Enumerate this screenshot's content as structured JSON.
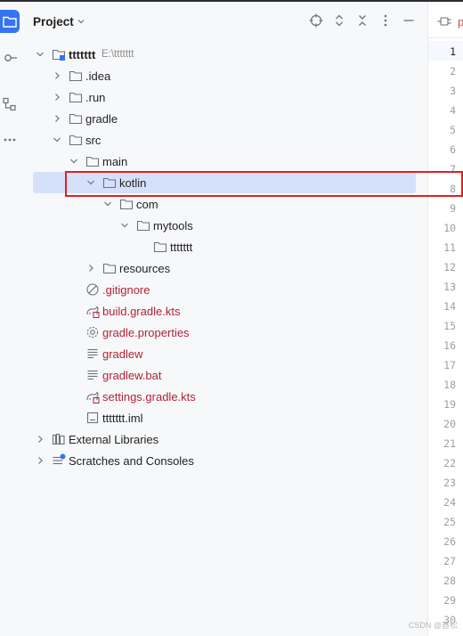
{
  "panel": {
    "title": "Project"
  },
  "tree": [
    {
      "label": "ttttttt",
      "path": "E:\\ttttttt",
      "level": 0,
      "expanded": true,
      "icon": "module-folder-icon",
      "bold": true
    },
    {
      "label": ".idea",
      "level": 1,
      "expanded": false,
      "icon": "folder-icon"
    },
    {
      "label": ".run",
      "level": 1,
      "expanded": false,
      "icon": "folder-icon"
    },
    {
      "label": "gradle",
      "level": 1,
      "expanded": false,
      "icon": "folder-icon"
    },
    {
      "label": "src",
      "level": 1,
      "expanded": true,
      "icon": "folder-icon"
    },
    {
      "label": "main",
      "level": 2,
      "expanded": true,
      "icon": "folder-icon"
    },
    {
      "label": "kotlin",
      "level": 3,
      "expanded": true,
      "icon": "folder-icon",
      "selected": true
    },
    {
      "label": "com",
      "level": 4,
      "expanded": true,
      "icon": "folder-icon"
    },
    {
      "label": "mytools",
      "level": 5,
      "expanded": true,
      "icon": "folder-icon"
    },
    {
      "label": "ttttttt",
      "level": 6,
      "icon": "folder-icon"
    },
    {
      "label": "resources",
      "level": 3,
      "expanded": false,
      "icon": "folder-icon"
    },
    {
      "label": ".gitignore",
      "level": 2,
      "icon": "ignore-file-icon",
      "red": true
    },
    {
      "label": "build.gradle.kts",
      "level": 2,
      "icon": "gradle-file-icon",
      "red": true
    },
    {
      "label": "gradle.properties",
      "level": 2,
      "icon": "settings-file-icon",
      "red": true
    },
    {
      "label": "gradlew",
      "level": 2,
      "icon": "text-file-icon",
      "red": true
    },
    {
      "label": "gradlew.bat",
      "level": 2,
      "icon": "text-file-icon",
      "red": true
    },
    {
      "label": "settings.gradle.kts",
      "level": 2,
      "icon": "gradle-file-icon",
      "red": true
    },
    {
      "label": "ttttttt.iml",
      "level": 2,
      "icon": "iml-file-icon"
    },
    {
      "label": "External Libraries",
      "level": 0,
      "expanded": false,
      "icon": "libraries-icon"
    },
    {
      "label": "Scratches and Consoles",
      "level": 0,
      "expanded": false,
      "icon": "scratches-icon"
    }
  ],
  "editor": {
    "tab_label": "p",
    "current_line": 1,
    "line_numbers": [
      "1",
      "2",
      "3",
      "4",
      "5",
      "6",
      "7",
      "8",
      "9",
      "10",
      "11",
      "12",
      "13",
      "14",
      "15",
      "16",
      "17",
      "18",
      "19",
      "20",
      "21",
      "22",
      "23",
      "24",
      "25",
      "26",
      "27",
      "28",
      "29",
      "30"
    ]
  },
  "watermark": "CSDN @苜松",
  "colors": {
    "accent": "#3574f0",
    "selection": "#d5e1fb",
    "unversioned_file": "#b22336",
    "highlight_box": "#e02020"
  }
}
